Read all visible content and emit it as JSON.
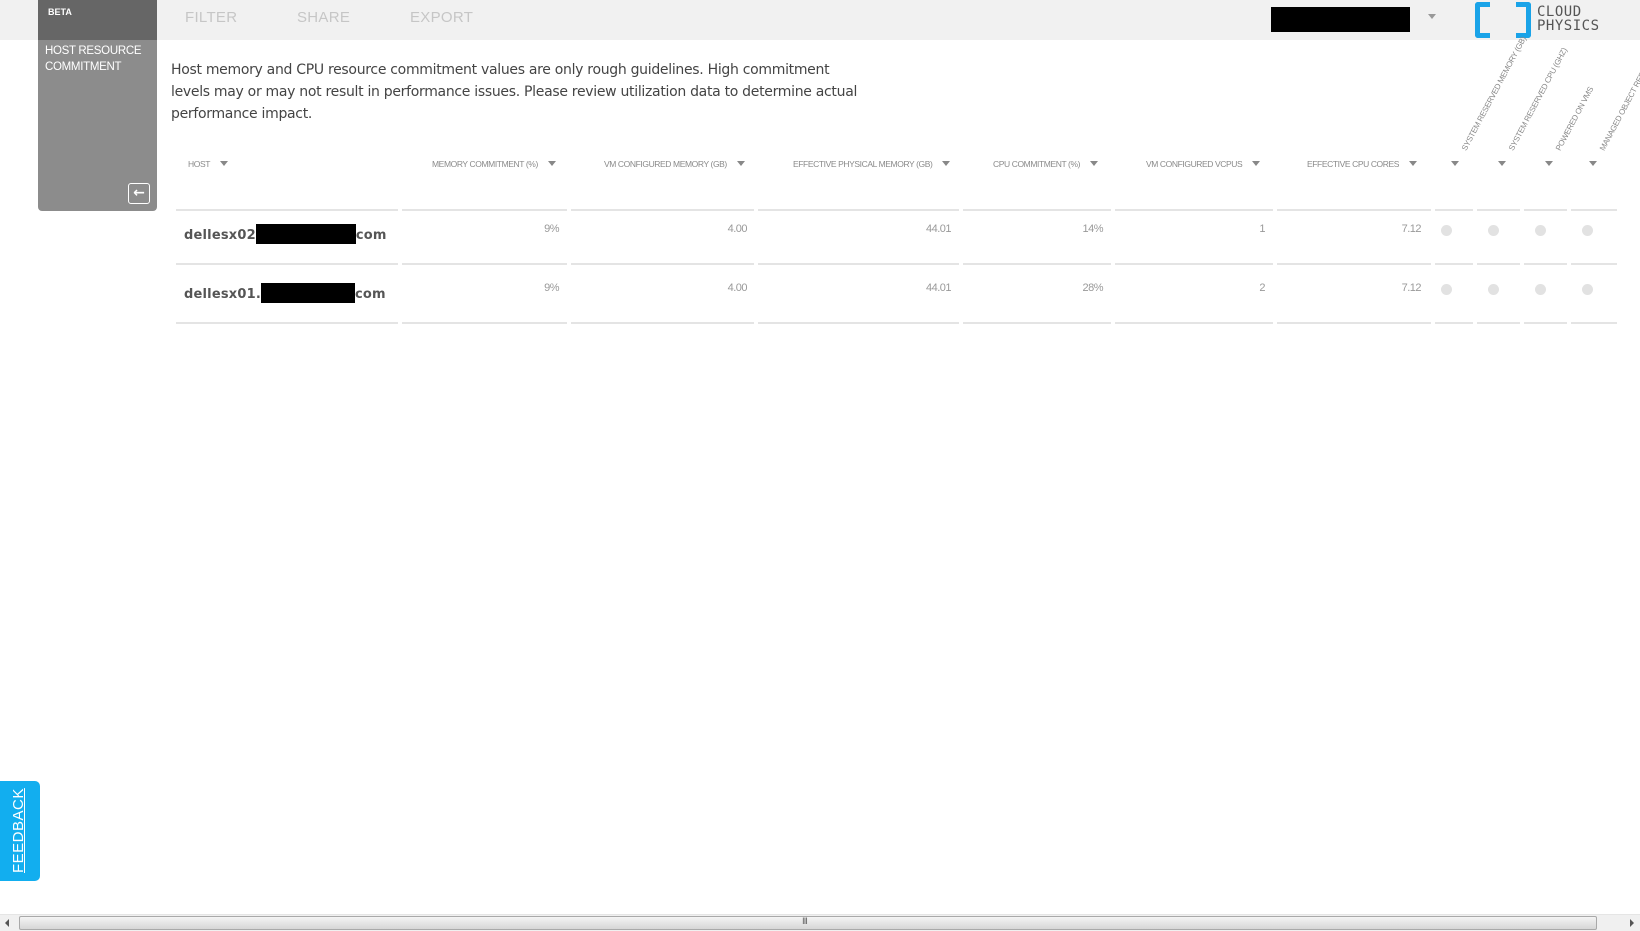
{
  "topbar": {
    "beta_label": "BETA",
    "nav": [
      {
        "label": "FILTER"
      },
      {
        "label": "SHARE"
      },
      {
        "label": "EXPORT"
      }
    ],
    "account_selector": {
      "value": "",
      "icon": "chevron-down-icon"
    },
    "logo": {
      "line1": "CLOUD",
      "line2": "PHYSICS",
      "brand_color": "#1aa3e8"
    }
  },
  "sidebar": {
    "title": "HOST RESOURCE COMMITMENT",
    "collapse_icon": "arrow-left-icon",
    "collapse_glyph": "←"
  },
  "description": "Host memory and CPU resource commitment values are only rough guidelines. High commitment levels may or may not result in performance issues. Please review utilization data to determine actual performance impact.",
  "table": {
    "columns": [
      {
        "label": "HOST"
      },
      {
        "label": "MEMORY COMMITMENT (%)"
      },
      {
        "label": "VM CONFIGURED MEMORY (GB)"
      },
      {
        "label": "EFFECTIVE PHYSICAL MEMORY (GB)"
      },
      {
        "label": "CPU COMMITMENT (%)"
      },
      {
        "label": "VM CONFIGURED VCPUS"
      },
      {
        "label": "EFFECTIVE CPU CORES"
      },
      {
        "label": "SYSTEM RESERVED MEMORY (GB)"
      },
      {
        "label": "SYSTEM RESERVED CPU (GHZ)"
      },
      {
        "label": "POWERED ON VMS"
      },
      {
        "label": "MANAGED OBJECT REFERENCE"
      }
    ],
    "rows": [
      {
        "host_prefix": "dellesx02",
        "host_suffix": "com",
        "memory_commitment": "9%",
        "vm_configured_memory": "4.00",
        "effective_physical_memory": "44.01",
        "cpu_commitment": "14%",
        "vm_configured_vcpus": "1",
        "effective_cpu_cores": "7.12"
      },
      {
        "host_prefix": "dellesx01.",
        "host_suffix": "com",
        "memory_commitment": "9%",
        "vm_configured_memory": "4.00",
        "effective_physical_memory": "44.01",
        "cpu_commitment": "28%",
        "vm_configured_vcpus": "2",
        "effective_cpu_cores": "7.12"
      }
    ]
  },
  "feedback": {
    "label": "FEEDBACK",
    "color": "#12aeef"
  },
  "scrollbar": {
    "grip": "III"
  }
}
